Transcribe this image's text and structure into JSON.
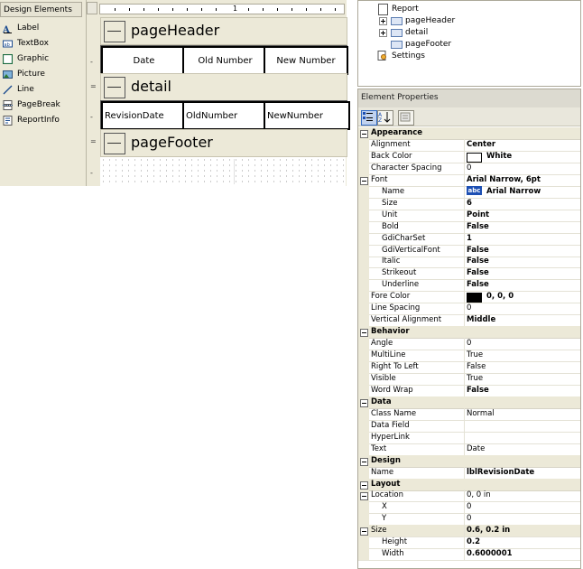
{
  "toolbox": {
    "title": "Design Elements",
    "items": [
      {
        "label": "Label",
        "icon": "label-icon"
      },
      {
        "label": "TextBox",
        "icon": "textbox-icon"
      },
      {
        "label": "Graphic",
        "icon": "graphic-icon"
      },
      {
        "label": "Picture",
        "icon": "picture-icon"
      },
      {
        "label": "Line",
        "icon": "line-icon"
      },
      {
        "label": "PageBreak",
        "icon": "pagebreak-icon"
      },
      {
        "label": "ReportInfo",
        "icon": "reportinfo-icon"
      }
    ]
  },
  "designer": {
    "ruler_label": "1",
    "bands": {
      "pageHeader": "pageHeader",
      "detail": "detail",
      "pageFooter": "pageFooter"
    },
    "header_cells": [
      "Date",
      "Old Number",
      "New Number"
    ],
    "detail_cells": [
      "RevisionDate",
      "OldNumber",
      "NewNumber"
    ]
  },
  "tree": {
    "root": "Report",
    "nodes": [
      "pageHeader",
      "detail",
      "pageFooter"
    ],
    "settings": "Settings"
  },
  "properties": {
    "title": "Element Properties",
    "rows": [
      {
        "type": "cat",
        "name": "Appearance"
      },
      {
        "name": "Alignment",
        "value": "Center",
        "bold": true
      },
      {
        "name": "Back Color",
        "value": "White",
        "bold": true,
        "swatch": "#ffffff"
      },
      {
        "name": "Character Spacing",
        "value": "0"
      },
      {
        "name": "Font",
        "value": "Arial Narrow, 6pt",
        "bold": true,
        "toggle": true
      },
      {
        "name": "Name",
        "value": "Arial Narrow",
        "bold": true,
        "sub": true,
        "abc": "abc"
      },
      {
        "name": "Size",
        "value": "6",
        "bold": true,
        "sub": true
      },
      {
        "name": "Unit",
        "value": "Point",
        "bold": true,
        "sub": true
      },
      {
        "name": "Bold",
        "value": "False",
        "bold": true,
        "sub": true
      },
      {
        "name": "GdiCharSet",
        "value": "1",
        "bold": true,
        "sub": true
      },
      {
        "name": "GdiVerticalFont",
        "value": "False",
        "bold": true,
        "sub": true
      },
      {
        "name": "Italic",
        "value": "False",
        "bold": true,
        "sub": true
      },
      {
        "name": "Strikeout",
        "value": "False",
        "bold": true,
        "sub": true
      },
      {
        "name": "Underline",
        "value": "False",
        "bold": true,
        "sub": true
      },
      {
        "name": "Fore Color",
        "value": "0, 0, 0",
        "bold": true,
        "swatch": "#000000"
      },
      {
        "name": "Line Spacing",
        "value": "0"
      },
      {
        "name": "Vertical Alignment",
        "value": "Middle",
        "bold": true
      },
      {
        "type": "cat",
        "name": "Behavior"
      },
      {
        "name": "Angle",
        "value": "0"
      },
      {
        "name": "MultiLine",
        "value": "True"
      },
      {
        "name": "Right To Left",
        "value": "False"
      },
      {
        "name": "Visible",
        "value": "True"
      },
      {
        "name": "Word Wrap",
        "value": "False",
        "bold": true
      },
      {
        "type": "cat",
        "name": "Data"
      },
      {
        "name": "Class Name",
        "value": "Normal"
      },
      {
        "name": "Data Field",
        "value": ""
      },
      {
        "name": "HyperLink",
        "value": ""
      },
      {
        "name": "Text",
        "value": "Date"
      },
      {
        "type": "cat",
        "name": "Design"
      },
      {
        "name": "Name",
        "value": "lblRevisionDate",
        "bold": true
      },
      {
        "type": "cat",
        "name": "Layout"
      },
      {
        "name": "Location",
        "value": "0, 0 in",
        "toggle": true
      },
      {
        "name": "X",
        "value": "0",
        "sub": true
      },
      {
        "name": "Y",
        "value": "0",
        "sub": true
      },
      {
        "name": "Size",
        "value": "0.6, 0.2 in",
        "bold": true,
        "toggle": true,
        "shade": true
      },
      {
        "name": "Height",
        "value": "0.2",
        "bold": true,
        "sub": true
      },
      {
        "name": "Width",
        "value": "0.6000001",
        "bold": true,
        "sub": true
      }
    ]
  }
}
